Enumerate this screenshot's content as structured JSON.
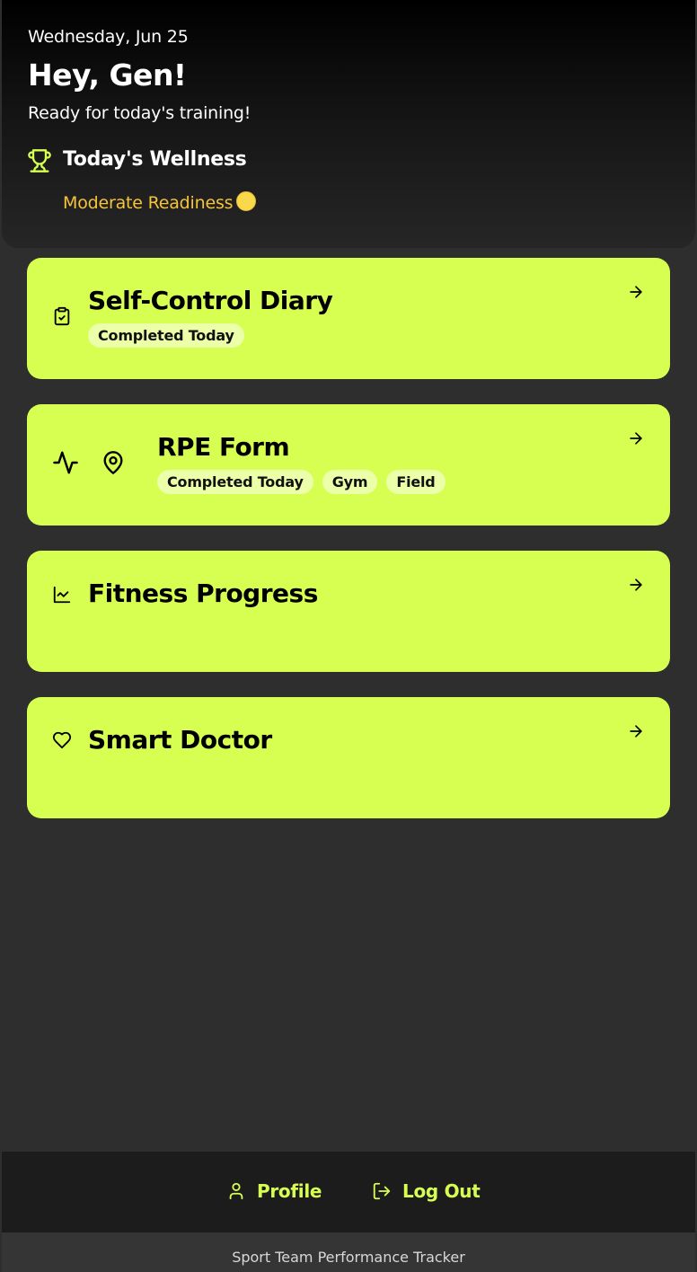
{
  "header": {
    "date": "Wednesday, Jun 25",
    "greeting": "Hey, Gen!",
    "subtitle": "Ready for today's training!",
    "wellness_title": "Today's Wellness",
    "readiness_text": "Moderate Readiness"
  },
  "cards": [
    {
      "title": "Self-Control Diary",
      "icon": "clipboard-check-icon",
      "tags": [
        "Completed Today"
      ]
    },
    {
      "title": "RPE Form",
      "icons": [
        "activity-icon",
        "map-pin-icon"
      ],
      "tags": [
        "Completed Today",
        "Gym",
        "Field"
      ]
    },
    {
      "title": "Fitness Progress",
      "icon": "line-chart-icon",
      "tags": []
    },
    {
      "title": "Smart Doctor",
      "icon": "heart-icon",
      "tags": []
    }
  ],
  "nav": {
    "profile_label": "Profile",
    "logout_label": "Log Out"
  },
  "footer": {
    "text": "Sport Team Performance Tracker"
  },
  "colors": {
    "accent": "#d7ff52",
    "readiness": "#f6c33a",
    "background": "#2e2e2e"
  }
}
